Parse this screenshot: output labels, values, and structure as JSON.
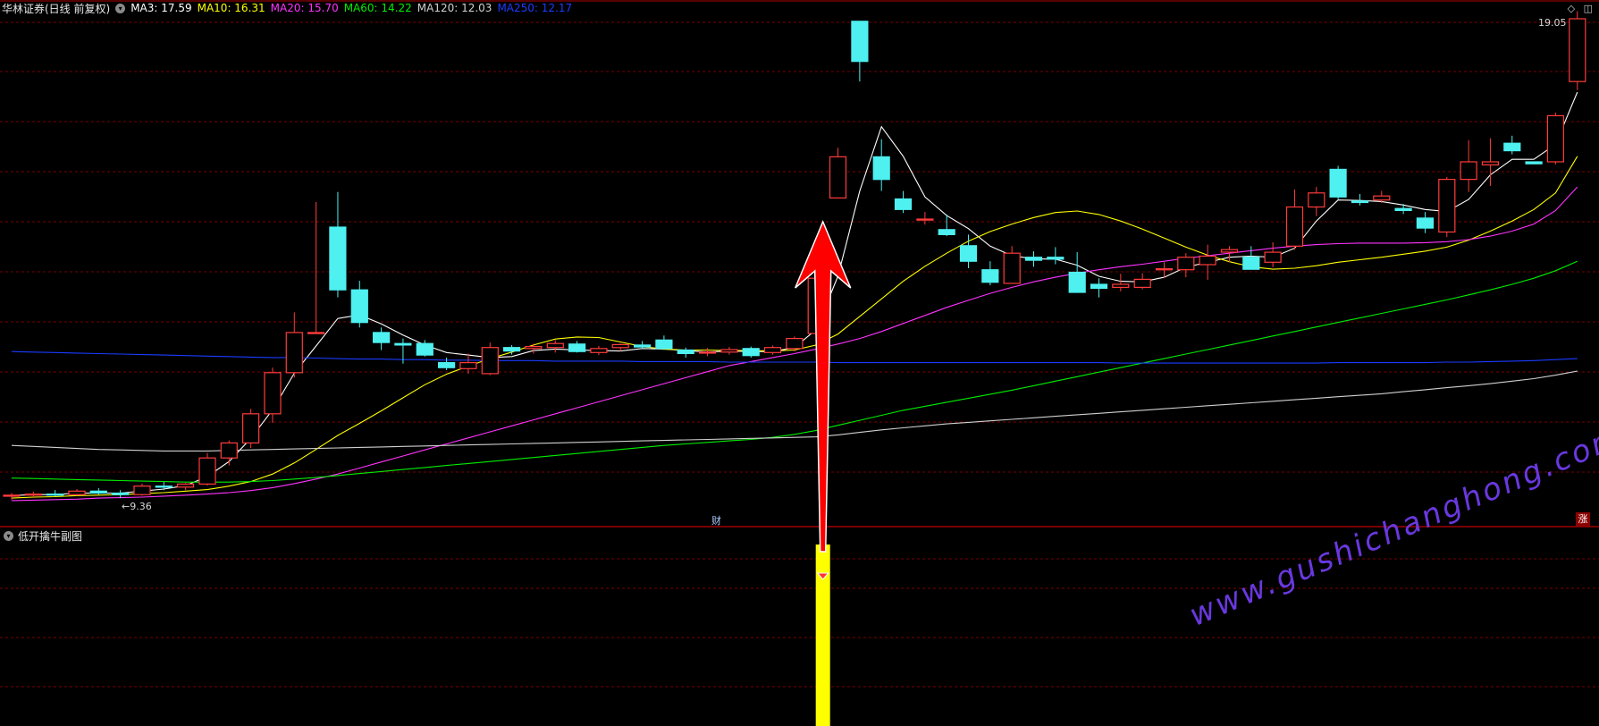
{
  "header": {
    "stock_title": "华林证券(日线 前复权)",
    "ma_items": [
      {
        "label": "MA3: 17.59",
        "color": "#ffffff"
      },
      {
        "label": "MA10: 16.31",
        "color": "#ffff00"
      },
      {
        "label": "MA20: 15.70",
        "color": "#ff33ff"
      },
      {
        "label": "MA60: 14.22",
        "color": "#00ee00"
      },
      {
        "label": "MA120: 12.03",
        "color": "#d0d0d0"
      },
      {
        "label": "MA250: 12.17",
        "color": "#1a3cff"
      }
    ]
  },
  "annotations": {
    "high_label": "19.05",
    "low_label": "←9.36",
    "cai_marker": "财",
    "zhang_badge": "涨",
    "top_right_icons": "◇ ◫"
  },
  "sub_panel": {
    "title": "低开擒牛副图"
  },
  "watermark": "www.gushichanghong.com",
  "colors": {
    "up": "#ff3b3b",
    "down": "#4ef0f0",
    "grid": "#7a0000",
    "signal_bar": "#ffff00",
    "arrow": "#ff0000"
  },
  "chart_data": {
    "type": "candlestick",
    "y_axis": {
      "min": 9.36,
      "max": 19.05
    },
    "candles": [
      [
        9.54,
        9.6,
        9.47,
        9.56
      ],
      [
        9.56,
        9.63,
        9.52,
        9.58
      ],
      [
        9.58,
        9.66,
        9.54,
        9.57
      ],
      [
        9.57,
        9.68,
        9.55,
        9.64
      ],
      [
        9.64,
        9.7,
        9.57,
        9.6
      ],
      [
        9.6,
        9.66,
        9.5,
        9.57
      ],
      [
        9.57,
        9.79,
        9.55,
        9.74
      ],
      [
        9.74,
        9.82,
        9.66,
        9.72
      ],
      [
        9.72,
        9.8,
        9.66,
        9.78
      ],
      [
        9.78,
        10.4,
        9.75,
        10.3
      ],
      [
        10.3,
        10.65,
        10.15,
        10.6
      ],
      [
        10.6,
        11.28,
        10.5,
        11.18
      ],
      [
        11.18,
        12.1,
        11.0,
        12.0
      ],
      [
        12.0,
        13.2,
        11.9,
        12.8
      ],
      [
        12.8,
        15.4,
        12.8,
        12.8
      ],
      [
        14.9,
        15.6,
        13.5,
        13.65
      ],
      [
        13.65,
        13.83,
        12.9,
        13.0
      ],
      [
        12.8,
        12.9,
        12.45,
        12.6
      ],
      [
        12.58,
        12.68,
        12.18,
        12.55
      ],
      [
        12.58,
        12.65,
        12.32,
        12.35
      ],
      [
        12.2,
        12.3,
        12.05,
        12.1
      ],
      [
        12.08,
        12.38,
        11.98,
        12.2
      ],
      [
        11.98,
        12.6,
        11.95,
        12.5
      ],
      [
        12.5,
        12.55,
        12.36,
        12.43
      ],
      [
        12.48,
        12.58,
        12.38,
        12.52
      ],
      [
        12.5,
        12.65,
        12.4,
        12.58
      ],
      [
        12.57,
        12.63,
        12.4,
        12.42
      ],
      [
        12.4,
        12.53,
        12.35,
        12.48
      ],
      [
        12.5,
        12.58,
        12.43,
        12.56
      ],
      [
        12.55,
        12.63,
        12.47,
        12.51
      ],
      [
        12.65,
        12.74,
        12.45,
        12.48
      ],
      [
        12.45,
        12.5,
        12.3,
        12.38
      ],
      [
        12.39,
        12.49,
        12.33,
        12.41
      ],
      [
        12.41,
        12.51,
        12.36,
        12.46
      ],
      [
        12.48,
        12.52,
        12.3,
        12.34
      ],
      [
        12.4,
        12.54,
        12.36,
        12.5
      ],
      [
        12.48,
        12.72,
        12.42,
        12.68
      ],
      [
        12.78,
        13.93,
        12.74,
        13.88
      ],
      [
        15.48,
        16.48,
        15.48,
        16.3
      ],
      [
        19.0,
        19.0,
        17.8,
        18.2
      ],
      [
        16.3,
        16.65,
        15.62,
        15.85
      ],
      [
        15.46,
        15.62,
        15.18,
        15.25
      ],
      [
        15.04,
        15.2,
        14.95,
        15.06
      ],
      [
        14.85,
        15.15,
        14.72,
        14.75
      ],
      [
        14.53,
        14.75,
        14.08,
        14.22
      ],
      [
        14.05,
        14.22,
        13.74,
        13.8
      ],
      [
        13.78,
        14.52,
        13.78,
        14.38
      ],
      [
        14.3,
        14.42,
        14.11,
        14.24
      ],
      [
        14.3,
        14.5,
        14.16,
        14.26
      ],
      [
        14.0,
        14.4,
        13.6,
        13.6
      ],
      [
        13.76,
        13.88,
        13.5,
        13.68
      ],
      [
        13.7,
        13.97,
        13.62,
        13.76
      ],
      [
        13.7,
        13.98,
        13.66,
        13.86
      ],
      [
        14.05,
        14.2,
        13.88,
        14.07
      ],
      [
        14.05,
        14.38,
        13.9,
        14.3
      ],
      [
        14.15,
        14.55,
        13.85,
        14.32
      ],
      [
        14.4,
        14.52,
        14.2,
        14.45
      ],
      [
        14.3,
        14.52,
        14.1,
        14.06
      ],
      [
        14.2,
        14.6,
        14.1,
        14.4
      ],
      [
        14.52,
        15.65,
        14.45,
        15.3
      ],
      [
        15.3,
        15.7,
        15.12,
        15.58
      ],
      [
        16.05,
        16.12,
        15.45,
        15.5
      ],
      [
        15.42,
        15.56,
        15.33,
        15.39
      ],
      [
        15.44,
        15.62,
        15.38,
        15.52
      ],
      [
        15.27,
        15.36,
        15.16,
        15.23
      ],
      [
        15.08,
        15.2,
        14.78,
        14.88
      ],
      [
        14.8,
        15.9,
        14.7,
        15.85
      ],
      [
        15.85,
        16.63,
        15.6,
        16.2
      ],
      [
        16.14,
        16.67,
        15.72,
        16.2
      ],
      [
        16.57,
        16.72,
        16.35,
        16.42
      ],
      [
        16.2,
        16.2,
        16.15,
        16.16
      ],
      [
        16.2,
        17.18,
        16.15,
        17.12
      ],
      [
        17.8,
        19.2,
        17.63,
        19.05
      ]
    ],
    "ma": [
      {
        "name": "MA3",
        "color": "#ffffff",
        "values": [
          9.55,
          9.57,
          9.57,
          9.6,
          9.6,
          9.6,
          9.64,
          9.68,
          9.75,
          9.93,
          10.23,
          10.69,
          11.26,
          11.99,
          12.53,
          13.08,
          13.15,
          12.97,
          12.75,
          12.55,
          12.4,
          12.35,
          12.3,
          12.32,
          12.44,
          12.47,
          12.45,
          12.44,
          12.43,
          12.48,
          12.47,
          12.44,
          12.41,
          12.43,
          12.42,
          12.42,
          12.5,
          12.86,
          13.92,
          15.62,
          16.9,
          16.31,
          15.5,
          15.13,
          14.87,
          14.52,
          14.33,
          14.27,
          14.26,
          14.14,
          13.92,
          13.82,
          13.81,
          13.9,
          14.1,
          14.2,
          14.3,
          14.32,
          14.3,
          14.48,
          15.02,
          15.44,
          15.43,
          15.41,
          15.34,
          15.25,
          15.21,
          15.45,
          15.94,
          16.25,
          16.25,
          16.55,
          17.59
        ]
      },
      {
        "name": "MA10",
        "color": "#ffff00",
        "values": [
          9.5,
          9.52,
          9.53,
          9.55,
          9.56,
          9.57,
          9.59,
          9.61,
          9.64,
          9.67,
          9.74,
          9.83,
          9.98,
          10.2,
          10.47,
          10.75,
          10.99,
          11.24,
          11.5,
          11.76,
          11.97,
          12.13,
          12.28,
          12.41,
          12.55,
          12.67,
          12.71,
          12.7,
          12.61,
          12.52,
          12.47,
          12.45,
          12.45,
          12.44,
          12.44,
          12.43,
          12.45,
          12.55,
          12.77,
          13.12,
          13.47,
          13.82,
          14.12,
          14.38,
          14.62,
          14.81,
          14.96,
          15.09,
          15.19,
          15.22,
          15.15,
          15.02,
          14.86,
          14.68,
          14.5,
          14.34,
          14.21,
          14.11,
          14.06,
          14.08,
          14.13,
          14.2,
          14.25,
          14.3,
          14.36,
          14.42,
          14.5,
          14.64,
          14.82,
          15.02,
          15.25,
          15.58,
          16.31
        ]
      },
      {
        "name": "MA20",
        "color": "#ff33ff",
        "values": [
          9.45,
          9.46,
          9.47,
          9.48,
          9.5,
          9.51,
          9.52,
          9.54,
          9.56,
          9.58,
          9.61,
          9.65,
          9.71,
          9.79,
          9.88,
          9.98,
          10.1,
          10.22,
          10.34,
          10.46,
          10.58,
          10.7,
          10.82,
          10.94,
          11.06,
          11.18,
          11.3,
          11.42,
          11.54,
          11.66,
          11.78,
          11.9,
          12.02,
          12.14,
          12.22,
          12.3,
          12.38,
          12.47,
          12.57,
          12.68,
          12.82,
          12.98,
          13.14,
          13.3,
          13.44,
          13.58,
          13.7,
          13.81,
          13.9,
          13.98,
          14.05,
          14.11,
          14.16,
          14.22,
          14.28,
          14.33,
          14.38,
          14.43,
          14.48,
          14.52,
          14.55,
          14.57,
          14.58,
          14.58,
          14.58,
          14.59,
          14.61,
          14.65,
          14.72,
          14.82,
          14.96,
          15.23,
          15.7
        ]
      },
      {
        "name": "MA60",
        "color": "#00ee00",
        "values": [
          9.9,
          9.89,
          9.88,
          9.87,
          9.86,
          9.85,
          9.84,
          9.83,
          9.82,
          9.82,
          9.82,
          9.83,
          9.85,
          9.88,
          9.91,
          9.95,
          9.99,
          10.03,
          10.07,
          10.11,
          10.15,
          10.19,
          10.23,
          10.27,
          10.31,
          10.35,
          10.39,
          10.43,
          10.47,
          10.51,
          10.55,
          10.58,
          10.61,
          10.64,
          10.67,
          10.71,
          10.77,
          10.85,
          10.95,
          11.05,
          11.15,
          11.25,
          11.33,
          11.41,
          11.49,
          11.57,
          11.65,
          11.74,
          11.83,
          11.92,
          12.01,
          12.1,
          12.19,
          12.28,
          12.37,
          12.46,
          12.55,
          12.64,
          12.73,
          12.82,
          12.91,
          13.0,
          13.09,
          13.18,
          13.27,
          13.36,
          13.45,
          13.55,
          13.65,
          13.76,
          13.88,
          14.03,
          14.22
        ]
      },
      {
        "name": "MA120",
        "color": "#d0d0d0",
        "values": [
          10.55,
          10.53,
          10.51,
          10.49,
          10.47,
          10.46,
          10.45,
          10.44,
          10.44,
          10.44,
          10.45,
          10.46,
          10.47,
          10.48,
          10.49,
          10.5,
          10.51,
          10.52,
          10.53,
          10.54,
          10.55,
          10.56,
          10.57,
          10.58,
          10.59,
          10.6,
          10.61,
          10.62,
          10.63,
          10.64,
          10.65,
          10.66,
          10.67,
          10.68,
          10.69,
          10.7,
          10.71,
          10.72,
          10.76,
          10.81,
          10.86,
          10.9,
          10.94,
          10.98,
          11.01,
          11.04,
          11.07,
          11.1,
          11.13,
          11.16,
          11.19,
          11.22,
          11.25,
          11.28,
          11.31,
          11.34,
          11.37,
          11.4,
          11.43,
          11.46,
          11.49,
          11.52,
          11.55,
          11.58,
          11.62,
          11.66,
          11.7,
          11.74,
          11.78,
          11.83,
          11.88,
          11.95,
          12.03
        ]
      },
      {
        "name": "MA250",
        "color": "#1a3cff",
        "values": [
          12.42,
          12.41,
          12.4,
          12.39,
          12.38,
          12.37,
          12.36,
          12.35,
          12.34,
          12.33,
          12.32,
          12.31,
          12.3,
          12.3,
          12.29,
          12.28,
          12.27,
          12.27,
          12.26,
          12.26,
          12.25,
          12.25,
          12.24,
          12.24,
          12.24,
          12.23,
          12.23,
          12.23,
          12.23,
          12.22,
          12.22,
          12.22,
          12.22,
          12.21,
          12.21,
          12.21,
          12.21,
          12.21,
          12.2,
          12.2,
          12.2,
          12.2,
          12.2,
          12.2,
          12.2,
          12.2,
          12.2,
          12.2,
          12.2,
          12.2,
          12.2,
          12.19,
          12.19,
          12.19,
          12.19,
          12.19,
          12.19,
          12.19,
          12.19,
          12.19,
          12.19,
          12.2,
          12.2,
          12.2,
          12.2,
          12.2,
          12.21,
          12.21,
          12.22,
          12.23,
          12.24,
          12.26,
          12.28
        ]
      }
    ],
    "signal": {
      "candle_index": 37,
      "indicator": "低开擒牛副图"
    }
  }
}
